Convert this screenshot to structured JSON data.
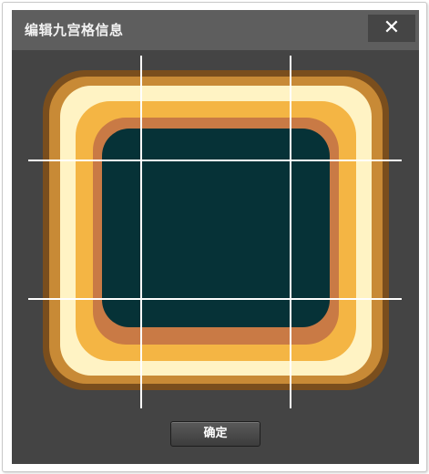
{
  "dialog": {
    "title": "编辑九宫格信息",
    "close_icon": "close-x-icon",
    "confirm_label": "确定"
  },
  "colors": {
    "dialog_background": "#444444",
    "titlebar_background": "#5e5e5e",
    "close_button_background": "#454545",
    "slice_guide_lines": "#ffffff",
    "frame_outer": "#7a4e1d",
    "frame_brown": "#c88a36",
    "frame_cream": "#fff3c4",
    "frame_orange": "#f4b544",
    "frame_copper": "#c97a45",
    "panel_center": "#063237"
  }
}
